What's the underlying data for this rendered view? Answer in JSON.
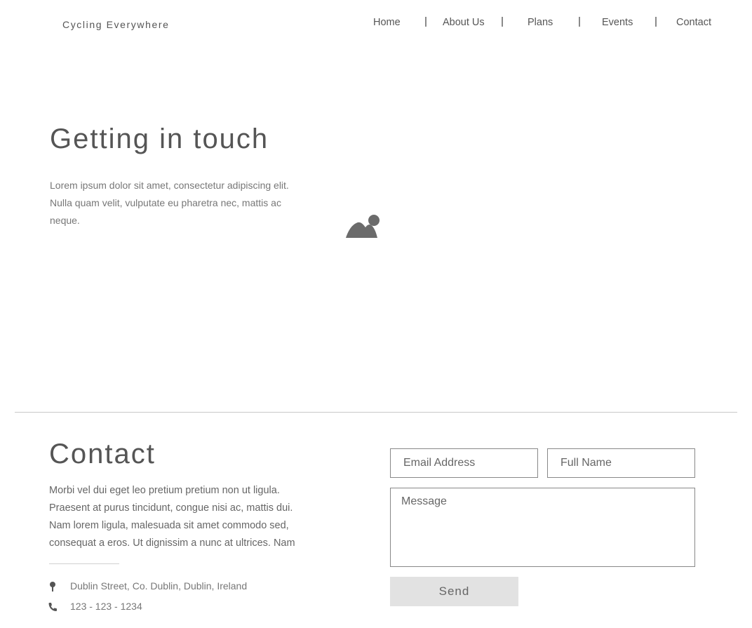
{
  "header": {
    "brand": "Cycling Everywhere",
    "nav": {
      "home": "Home",
      "about": "About Us",
      "plans": "Plans",
      "events": "Events",
      "contact": "Contact"
    }
  },
  "hero": {
    "title": "Getting in touch",
    "text": "Lorem ipsum dolor sit amet, consectetur adipiscing elit. Nulla quam velit, vulputate eu pharetra nec, mattis ac neque.",
    "image_icon": "image-placeholder-icon"
  },
  "contact": {
    "title": "Contact",
    "text": "Morbi vel dui eget leo pretium pretium non ut ligula. Praesent at purus tincidunt, congue nisi ac, mattis dui. Nam lorem ligula, malesuada sit amet commodo sed, consequat a eros. Ut dignissim a nunc at ultrices. Nam",
    "address": "Dublin Street, Co. Dublin, Dublin, Ireland",
    "phone": "123 - 123 - 1234",
    "icons": {
      "address": "map-pin-icon",
      "phone": "phone-icon"
    }
  },
  "form": {
    "email_placeholder": "Email Address",
    "name_placeholder": "Full Name",
    "message_placeholder": "Message",
    "send_label": "Send"
  },
  "colors": {
    "text": "#555555",
    "muted": "#777777",
    "button_bg": "#e2e2e2",
    "border": "#888888"
  }
}
